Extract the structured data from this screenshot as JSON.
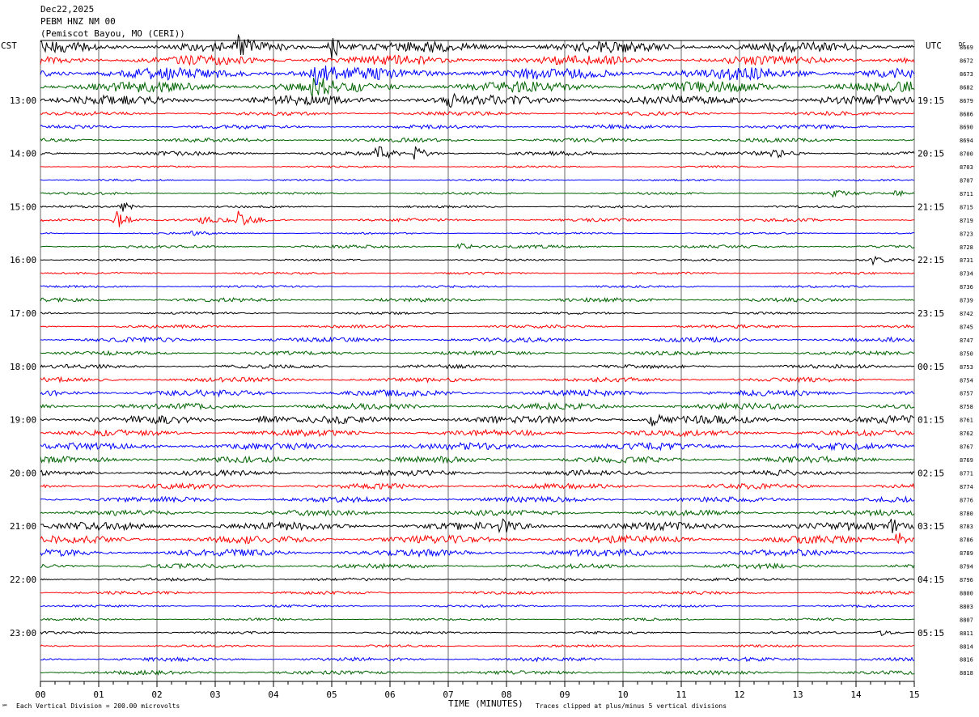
{
  "header": {
    "date": "Dec22,2025",
    "channel": "PEBM HNZ NM 00",
    "station": "(Pemiscot Bayou, MO (CERI))"
  },
  "left_zone": "CST",
  "right_zone": "UTC",
  "dc_header": "DC",
  "footer": {
    "mark": "℠",
    "scale": "Each Vertical Division =  200.00 microvolts",
    "clip": "Traces clipped at plus/minus 5 vertical divisions"
  },
  "colors": {
    "trace_cycle": [
      "#000000",
      "#ff0000",
      "#0000ff",
      "#006400"
    ],
    "grid": "#000000"
  },
  "chart_data": {
    "type": "line",
    "xlabel": "TIME (MINUTES)",
    "xlim": [
      0,
      15
    ],
    "x_ticks": [
      "00",
      "01",
      "02",
      "03",
      "04",
      "05",
      "06",
      "07",
      "08",
      "09",
      "10",
      "11",
      "12",
      "13",
      "14",
      "15"
    ],
    "hour_labels_left": [
      {
        "row": 4,
        "text": "13:00"
      },
      {
        "row": 8,
        "text": "14:00"
      },
      {
        "row": 12,
        "text": "15:00"
      },
      {
        "row": 16,
        "text": "16:00"
      },
      {
        "row": 20,
        "text": "17:00"
      },
      {
        "row": 24,
        "text": "18:00"
      },
      {
        "row": 28,
        "text": "19:00"
      },
      {
        "row": 32,
        "text": "20:00"
      },
      {
        "row": 36,
        "text": "21:00"
      },
      {
        "row": 40,
        "text": "22:00"
      },
      {
        "row": 44,
        "text": "23:00"
      }
    ],
    "hour_labels_right": [
      {
        "row": 4,
        "text": "19:15"
      },
      {
        "row": 8,
        "text": "20:15"
      },
      {
        "row": 12,
        "text": "21:15"
      },
      {
        "row": 16,
        "text": "22:15"
      },
      {
        "row": 20,
        "text": "23:15"
      },
      {
        "row": 24,
        "text": "00:15"
      },
      {
        "row": 28,
        "text": "01:15"
      },
      {
        "row": 32,
        "text": "02:15"
      },
      {
        "row": 36,
        "text": "03:15"
      },
      {
        "row": 40,
        "text": "04:15"
      },
      {
        "row": 44,
        "text": "05:15"
      }
    ],
    "dc_values": [
      "8669",
      "8672",
      "8673",
      "8682",
      "8679",
      "8686",
      "8690",
      "8694",
      "8700",
      "8703",
      "8707",
      "8711",
      "8715",
      "8719",
      "8723",
      "8728",
      "8731",
      "8734",
      "8736",
      "8739",
      "8742",
      "8745",
      "8747",
      "8750",
      "8753",
      "8754",
      "8757",
      "8758",
      "8761",
      "8762",
      "8767",
      "8769",
      "8771",
      "8774",
      "8776",
      "8780",
      "8783",
      "8786",
      "8789",
      "8794",
      "8796",
      "8800",
      "8803",
      "8807",
      "8811",
      "8814",
      "8816",
      "8818"
    ],
    "noise_level": [
      7,
      6,
      8,
      7,
      6,
      2.5,
      2.5,
      2.5,
      2.5,
      1.2,
      1.2,
      1.5,
      1.5,
      2,
      1.2,
      2,
      1.2,
      1.5,
      1.5,
      2.5,
      1.5,
      2,
      3,
      2.5,
      2.5,
      3,
      4,
      4,
      5,
      4,
      4.5,
      4,
      3.5,
      3.5,
      3.5,
      3.5,
      5,
      5,
      4.5,
      3,
      2,
      2,
      1.5,
      1.5,
      1.5,
      1.5,
      2.5,
      2.5
    ],
    "events": [
      {
        "row": 0,
        "minute": 5.0,
        "amplitude": 18
      },
      {
        "row": 0,
        "minute": 3.4,
        "amplitude": 8
      },
      {
        "row": 2,
        "minute": 4.7,
        "amplitude": 14
      },
      {
        "row": 3,
        "minute": 4.7,
        "amplitude": 10
      },
      {
        "row": 4,
        "minute": 7.0,
        "amplitude": 9
      },
      {
        "row": 8,
        "minute": 5.8,
        "amplitude": 10
      },
      {
        "row": 8,
        "minute": 6.4,
        "amplitude": 9
      },
      {
        "row": 8,
        "minute": 12.6,
        "amplitude": 5
      },
      {
        "row": 11,
        "minute": 13.6,
        "amplitude": 5
      },
      {
        "row": 11,
        "minute": 14.7,
        "amplitude": 4
      },
      {
        "row": 12,
        "minute": 1.4,
        "amplitude": 6
      },
      {
        "row": 13,
        "minute": 1.3,
        "amplitude": 12
      },
      {
        "row": 13,
        "minute": 3.4,
        "amplitude": 13
      },
      {
        "row": 13,
        "minute": 2.8,
        "amplitude": 5
      },
      {
        "row": 14,
        "minute": 2.6,
        "amplitude": 4
      },
      {
        "row": 15,
        "minute": 7.2,
        "amplitude": 5
      },
      {
        "row": 16,
        "minute": 14.3,
        "amplitude": 6
      },
      {
        "row": 28,
        "minute": 3.8,
        "amplitude": 8
      },
      {
        "row": 28,
        "minute": 10.5,
        "amplitude": 7
      },
      {
        "row": 36,
        "minute": 7.9,
        "amplitude": 9
      },
      {
        "row": 36,
        "minute": 14.6,
        "amplitude": 8
      },
      {
        "row": 37,
        "minute": 14.7,
        "amplitude": 10
      },
      {
        "row": 44,
        "minute": 14.4,
        "amplitude": 5
      }
    ]
  }
}
